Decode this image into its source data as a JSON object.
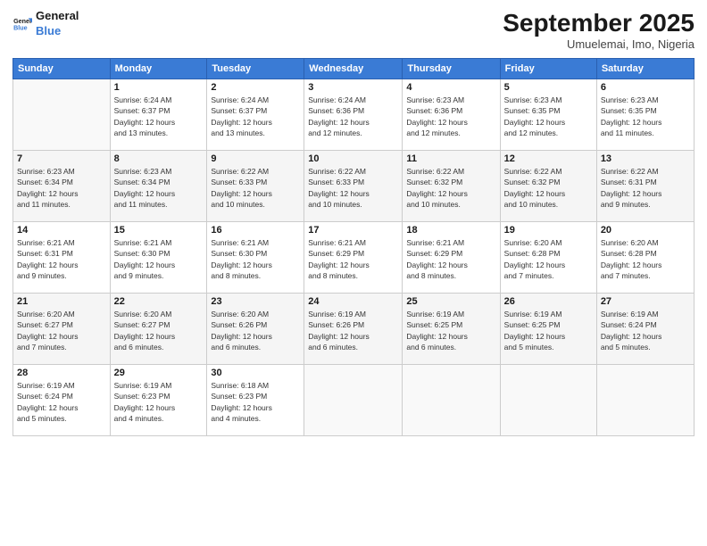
{
  "logo": {
    "line1": "General",
    "line2": "Blue"
  },
  "title": "September 2025",
  "subtitle": "Umuelemai, Imo, Nigeria",
  "header_days": [
    "Sunday",
    "Monday",
    "Tuesday",
    "Wednesday",
    "Thursday",
    "Friday",
    "Saturday"
  ],
  "weeks": [
    [
      {
        "num": "",
        "info": ""
      },
      {
        "num": "1",
        "info": "Sunrise: 6:24 AM\nSunset: 6:37 PM\nDaylight: 12 hours\nand 13 minutes."
      },
      {
        "num": "2",
        "info": "Sunrise: 6:24 AM\nSunset: 6:37 PM\nDaylight: 12 hours\nand 13 minutes."
      },
      {
        "num": "3",
        "info": "Sunrise: 6:24 AM\nSunset: 6:36 PM\nDaylight: 12 hours\nand 12 minutes."
      },
      {
        "num": "4",
        "info": "Sunrise: 6:23 AM\nSunset: 6:36 PM\nDaylight: 12 hours\nand 12 minutes."
      },
      {
        "num": "5",
        "info": "Sunrise: 6:23 AM\nSunset: 6:35 PM\nDaylight: 12 hours\nand 12 minutes."
      },
      {
        "num": "6",
        "info": "Sunrise: 6:23 AM\nSunset: 6:35 PM\nDaylight: 12 hours\nand 11 minutes."
      }
    ],
    [
      {
        "num": "7",
        "info": "Sunrise: 6:23 AM\nSunset: 6:34 PM\nDaylight: 12 hours\nand 11 minutes."
      },
      {
        "num": "8",
        "info": "Sunrise: 6:23 AM\nSunset: 6:34 PM\nDaylight: 12 hours\nand 11 minutes."
      },
      {
        "num": "9",
        "info": "Sunrise: 6:22 AM\nSunset: 6:33 PM\nDaylight: 12 hours\nand 10 minutes."
      },
      {
        "num": "10",
        "info": "Sunrise: 6:22 AM\nSunset: 6:33 PM\nDaylight: 12 hours\nand 10 minutes."
      },
      {
        "num": "11",
        "info": "Sunrise: 6:22 AM\nSunset: 6:32 PM\nDaylight: 12 hours\nand 10 minutes."
      },
      {
        "num": "12",
        "info": "Sunrise: 6:22 AM\nSunset: 6:32 PM\nDaylight: 12 hours\nand 10 minutes."
      },
      {
        "num": "13",
        "info": "Sunrise: 6:22 AM\nSunset: 6:31 PM\nDaylight: 12 hours\nand 9 minutes."
      }
    ],
    [
      {
        "num": "14",
        "info": "Sunrise: 6:21 AM\nSunset: 6:31 PM\nDaylight: 12 hours\nand 9 minutes."
      },
      {
        "num": "15",
        "info": "Sunrise: 6:21 AM\nSunset: 6:30 PM\nDaylight: 12 hours\nand 9 minutes."
      },
      {
        "num": "16",
        "info": "Sunrise: 6:21 AM\nSunset: 6:30 PM\nDaylight: 12 hours\nand 8 minutes."
      },
      {
        "num": "17",
        "info": "Sunrise: 6:21 AM\nSunset: 6:29 PM\nDaylight: 12 hours\nand 8 minutes."
      },
      {
        "num": "18",
        "info": "Sunrise: 6:21 AM\nSunset: 6:29 PM\nDaylight: 12 hours\nand 8 minutes."
      },
      {
        "num": "19",
        "info": "Sunrise: 6:20 AM\nSunset: 6:28 PM\nDaylight: 12 hours\nand 7 minutes."
      },
      {
        "num": "20",
        "info": "Sunrise: 6:20 AM\nSunset: 6:28 PM\nDaylight: 12 hours\nand 7 minutes."
      }
    ],
    [
      {
        "num": "21",
        "info": "Sunrise: 6:20 AM\nSunset: 6:27 PM\nDaylight: 12 hours\nand 7 minutes."
      },
      {
        "num": "22",
        "info": "Sunrise: 6:20 AM\nSunset: 6:27 PM\nDaylight: 12 hours\nand 6 minutes."
      },
      {
        "num": "23",
        "info": "Sunrise: 6:20 AM\nSunset: 6:26 PM\nDaylight: 12 hours\nand 6 minutes."
      },
      {
        "num": "24",
        "info": "Sunrise: 6:19 AM\nSunset: 6:26 PM\nDaylight: 12 hours\nand 6 minutes."
      },
      {
        "num": "25",
        "info": "Sunrise: 6:19 AM\nSunset: 6:25 PM\nDaylight: 12 hours\nand 6 minutes."
      },
      {
        "num": "26",
        "info": "Sunrise: 6:19 AM\nSunset: 6:25 PM\nDaylight: 12 hours\nand 5 minutes."
      },
      {
        "num": "27",
        "info": "Sunrise: 6:19 AM\nSunset: 6:24 PM\nDaylight: 12 hours\nand 5 minutes."
      }
    ],
    [
      {
        "num": "28",
        "info": "Sunrise: 6:19 AM\nSunset: 6:24 PM\nDaylight: 12 hours\nand 5 minutes."
      },
      {
        "num": "29",
        "info": "Sunrise: 6:19 AM\nSunset: 6:23 PM\nDaylight: 12 hours\nand 4 minutes."
      },
      {
        "num": "30",
        "info": "Sunrise: 6:18 AM\nSunset: 6:23 PM\nDaylight: 12 hours\nand 4 minutes."
      },
      {
        "num": "",
        "info": ""
      },
      {
        "num": "",
        "info": ""
      },
      {
        "num": "",
        "info": ""
      },
      {
        "num": "",
        "info": ""
      }
    ]
  ]
}
